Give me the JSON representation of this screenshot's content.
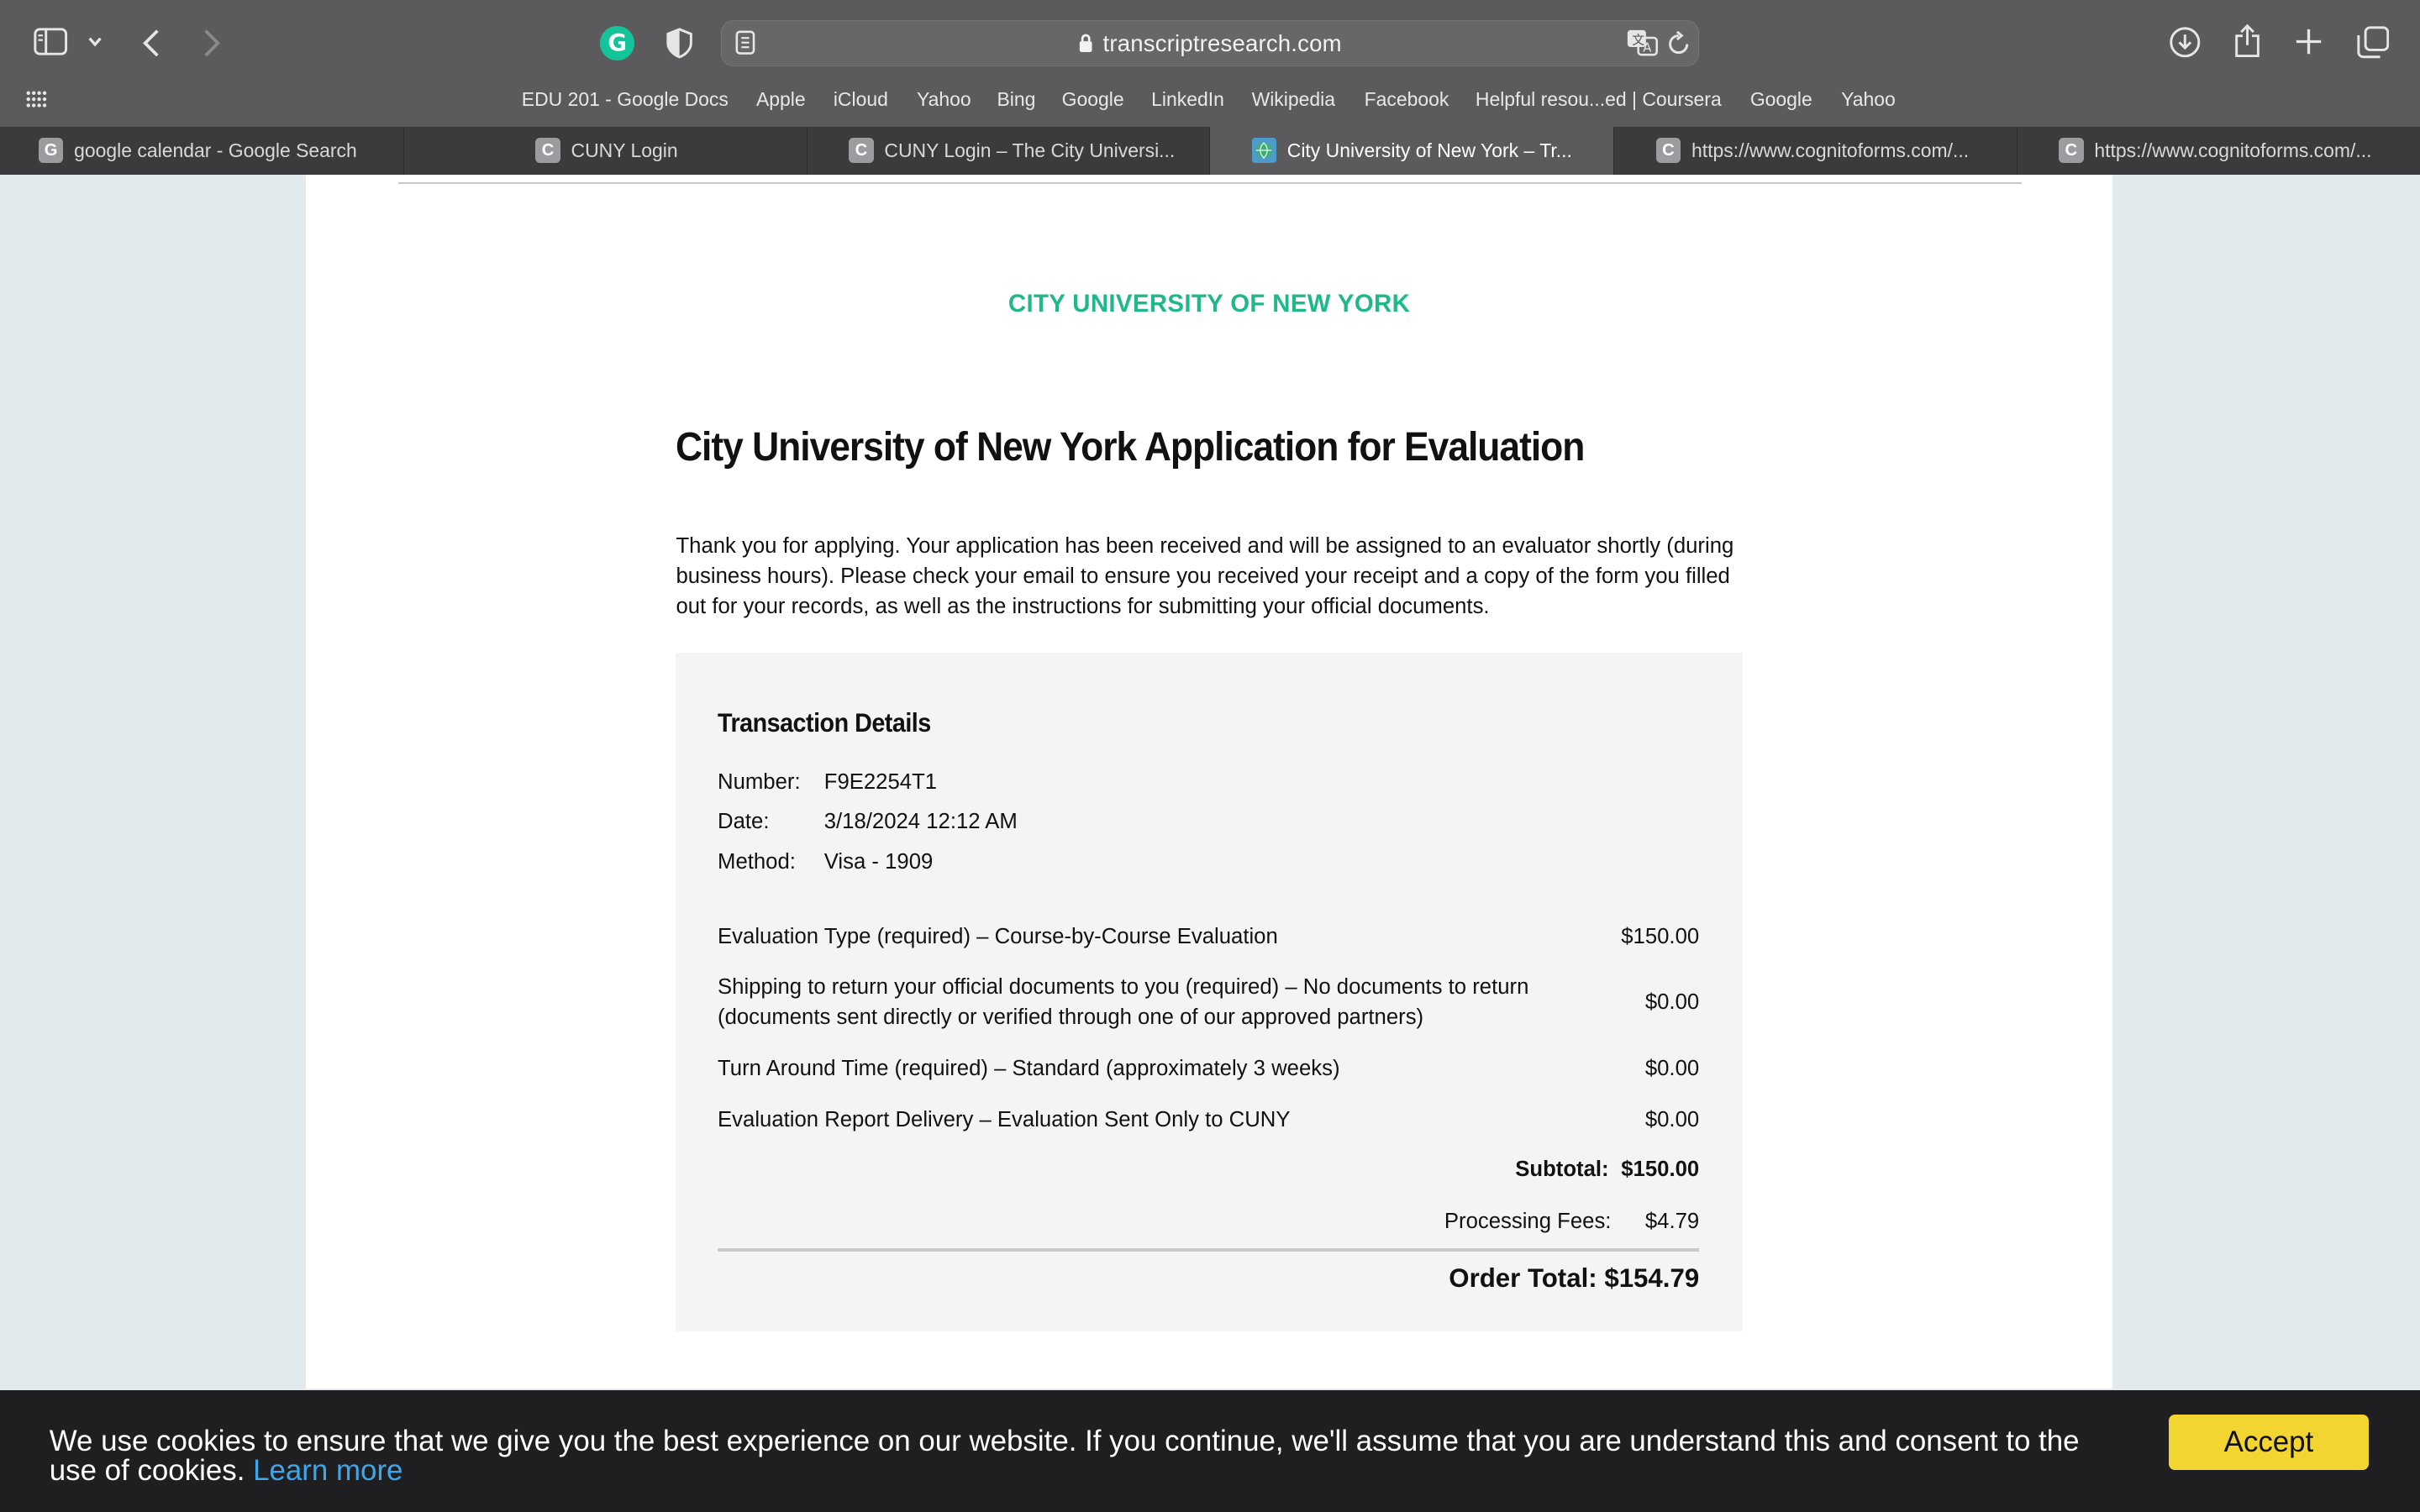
{
  "browser": {
    "url": "transcriptresearch.com",
    "favorites": [
      "EDU 201 - Google Docs",
      "Apple",
      "iCloud",
      "Yahoo",
      "Bing",
      "Google",
      "LinkedIn",
      "Wikipedia",
      "Facebook",
      "Helpful resou...ed | Coursera",
      "Google",
      "Yahoo"
    ],
    "tabs": [
      {
        "title": "google calendar - Google Search",
        "favicon": "G"
      },
      {
        "title": "CUNY Login",
        "favicon": "C"
      },
      {
        "title": "CUNY Login – The City Universi...",
        "favicon": "C"
      },
      {
        "title": "City University of New York – Tr...",
        "favicon": "",
        "active": true
      },
      {
        "title": "https://www.cognitoforms.com/...",
        "favicon": "C"
      },
      {
        "title": "https://www.cognitoforms.com/...",
        "favicon": "C"
      }
    ],
    "grammarly_glyph": "G"
  },
  "page": {
    "org_name": "CITY UNIVERSITY OF NEW YORK",
    "title": "City University of New York Application for Evaluation",
    "intro": "Thank you for applying. Your application has been received and will be assigned to an evaluator shortly (during business hours). Please check your email to ensure you received your receipt and a copy of the form you filled out for your records, as well as the instructions for submitting your official documents.",
    "transaction": {
      "heading": "Transaction Details",
      "number_label": "Number:",
      "number": "F9E2254T1",
      "date_label": "Date:",
      "date": "3/18/2024 12:12 AM",
      "method_label": "Method:",
      "method": "Visa - 1909",
      "items": [
        {
          "desc": "Evaluation Type (required) – Course-by-Course Evaluation",
          "amount": "$150.00"
        },
        {
          "desc": "Shipping to return your official documents to you (required) – No documents to return (documents sent directly or verified through one of our approved partners)",
          "amount": "$0.00"
        },
        {
          "desc": "Turn Around Time (required) – Standard (approximately 3 weeks)",
          "amount": "$0.00"
        },
        {
          "desc": "Evaluation Report Delivery – Evaluation Sent Only to CUNY",
          "amount": "$0.00"
        }
      ],
      "subtotal_label": "Subtotal:",
      "subtotal": "$150.00",
      "fees_label": "Processing Fees:",
      "fees": "$4.79",
      "total_label": "Order Total:",
      "total": "$154.79"
    }
  },
  "cookie_bar": {
    "text": "We use cookies to ensure that we give you the best experience on our website. If you continue, we'll assume that you are understand this and consent to the use of cookies.",
    "learn_more": "Learn more",
    "accept_label": "Accept"
  },
  "colors": {
    "accent_green": "#1fb88a",
    "accept_yellow": "#f2d531",
    "link_blue": "#3ea6ea"
  }
}
